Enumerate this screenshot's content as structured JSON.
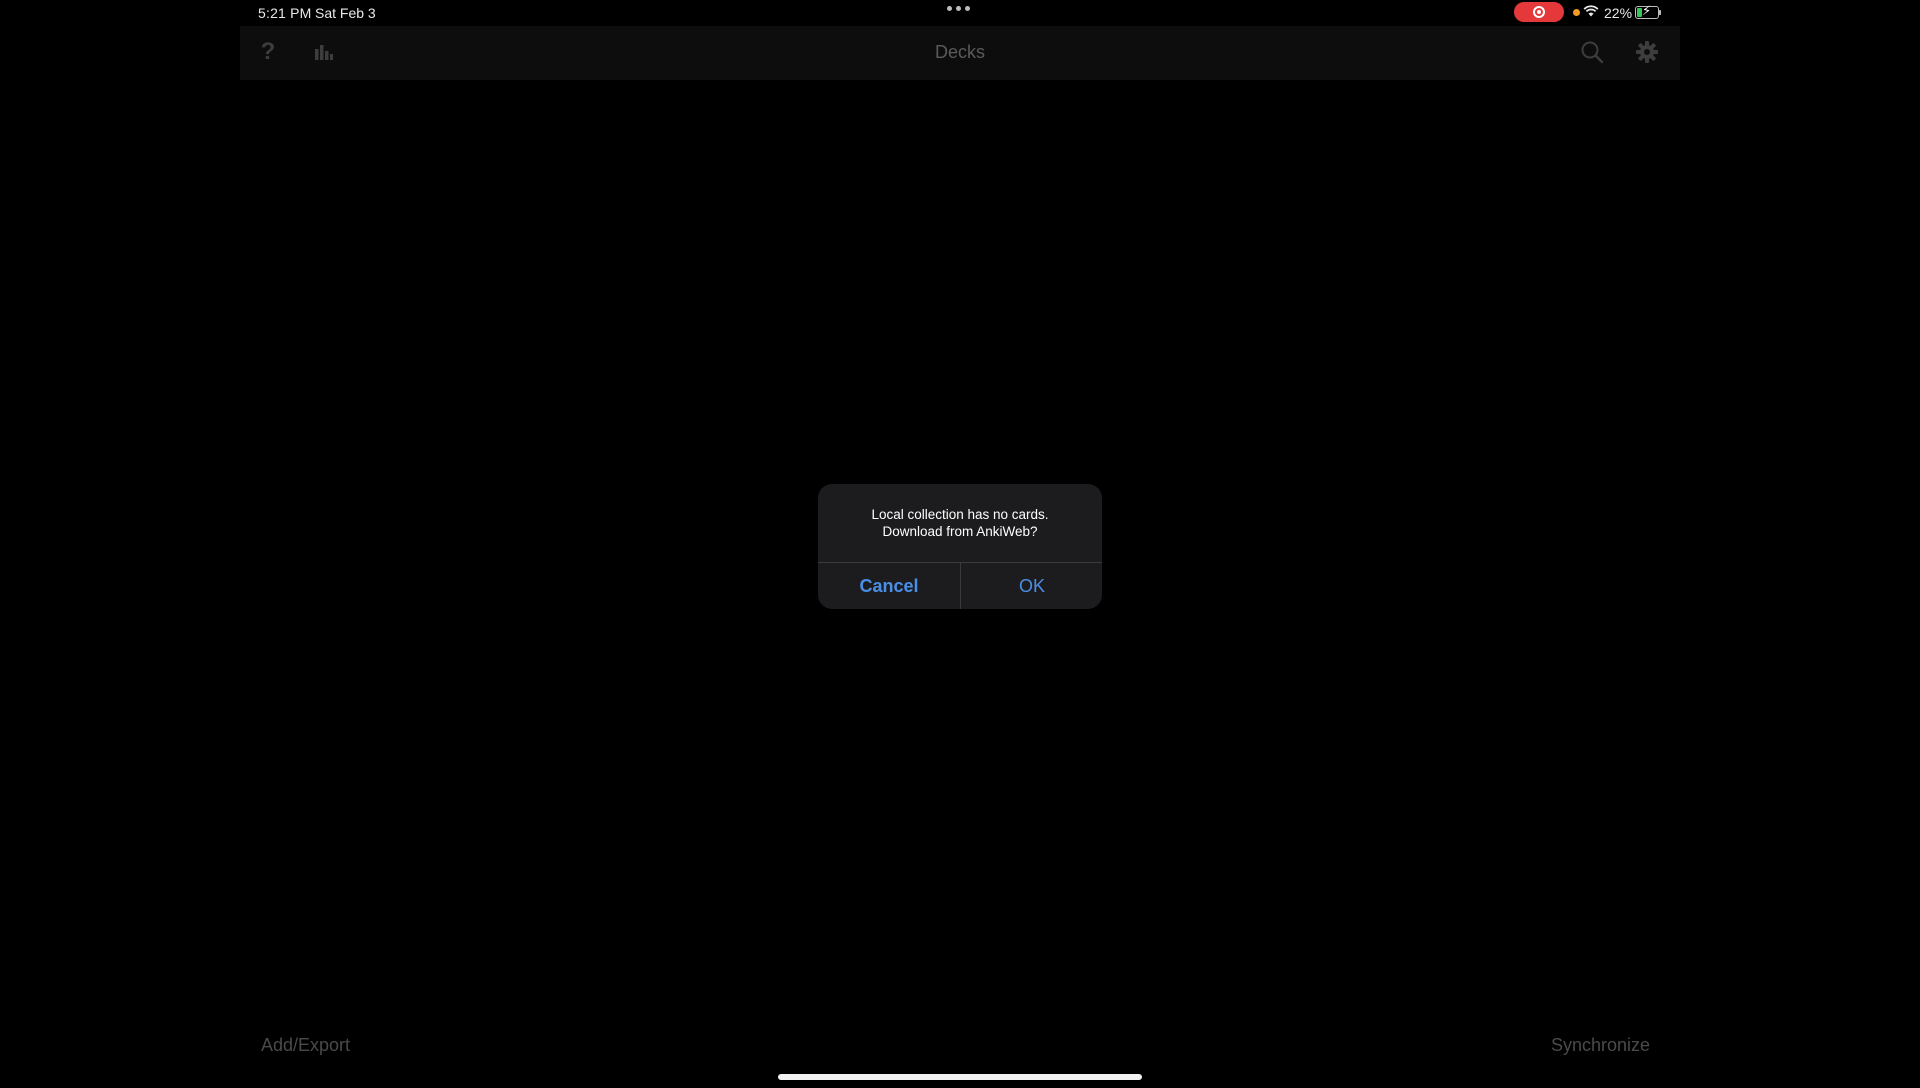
{
  "status_bar": {
    "time": "5:21 PM",
    "date": "Sat Feb 3",
    "battery_percent": "22%",
    "battery_level": 0.22,
    "recording_color": "#e5383b",
    "indicator_dot_color": "#f59a23"
  },
  "navbar": {
    "title": "Decks",
    "help_icon": "question-mark-icon",
    "stats_icon": "bar-chart-icon",
    "search_icon": "search-icon",
    "settings_icon": "gear-icon"
  },
  "alert": {
    "message_line1": "Local collection has no cards.",
    "message_line2": "Download from AnkiWeb?",
    "cancel_label": "Cancel",
    "ok_label": "OK",
    "button_color": "#4a8fe7"
  },
  "bottom_toolbar": {
    "left_label": "Add/Export",
    "right_label": "Synchronize"
  }
}
